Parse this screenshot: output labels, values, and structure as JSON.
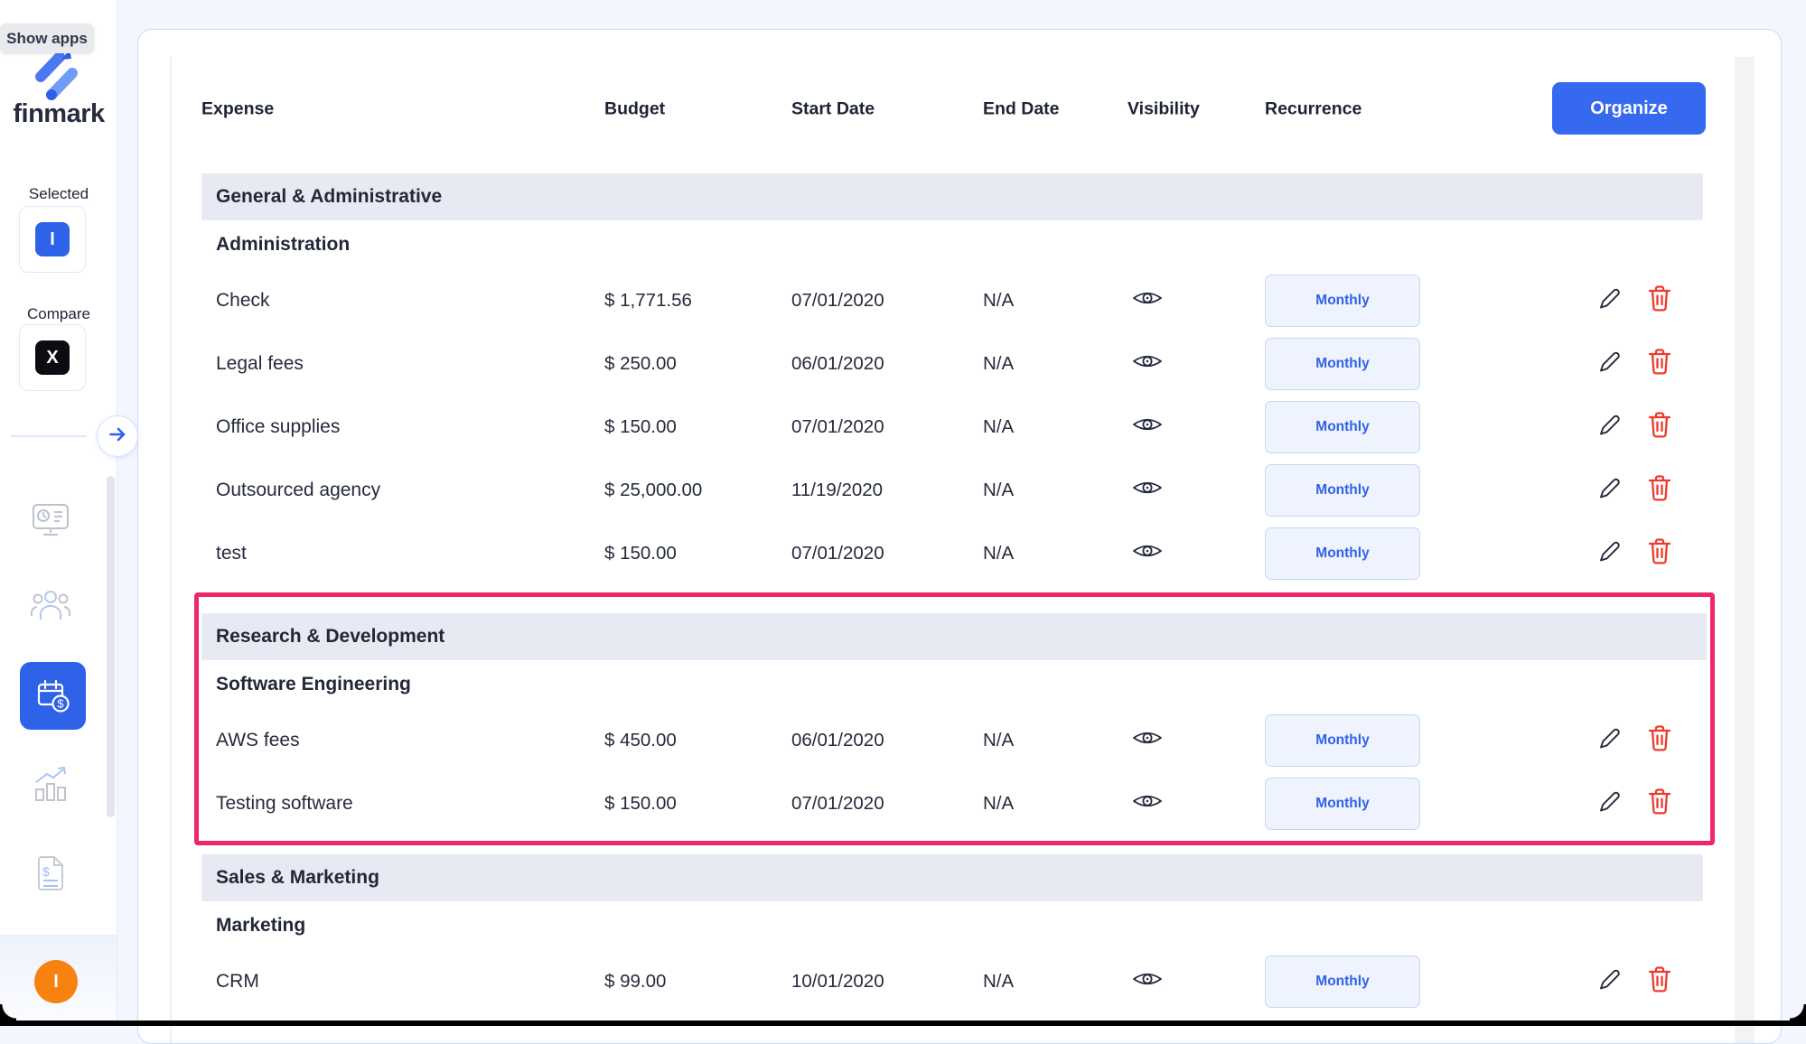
{
  "tooltip": "Show apps",
  "brand": "finmark",
  "sidebar": {
    "selected_label": "Selected",
    "selected_badge": "I",
    "compare_label": "Compare",
    "compare_badge": "X",
    "nav_icons": [
      "dashboard-monitor-icon",
      "team-people-icon",
      "expenses-calendar-dollar-icon",
      "charts-bar-trend-icon",
      "invoices-document-dollar-icon"
    ],
    "active_nav": "expenses-calendar-dollar-icon",
    "avatar_initial": "I"
  },
  "toolbar": {
    "organize_label": "Organize"
  },
  "table": {
    "columns": [
      "Expense",
      "Budget",
      "Start Date",
      "End Date",
      "Visibility",
      "Recurrence"
    ],
    "row_icons": [
      "eye-icon",
      "edit-pencil-icon",
      "delete-trash-icon"
    ],
    "sections": [
      {
        "name": "General & Administrative",
        "highlight": false,
        "subsections": [
          {
            "name": "Administration",
            "rows": [
              {
                "expense": "Check",
                "budget": "$ 1,771.56",
                "start": "07/01/2020",
                "end": "N/A",
                "recurrence": "Monthly"
              },
              {
                "expense": "Legal fees",
                "budget": "$ 250.00",
                "start": "06/01/2020",
                "end": "N/A",
                "recurrence": "Monthly"
              },
              {
                "expense": "Office supplies",
                "budget": "$ 150.00",
                "start": "07/01/2020",
                "end": "N/A",
                "recurrence": "Monthly"
              },
              {
                "expense": "Outsourced agency",
                "budget": "$ 25,000.00",
                "start": "11/19/2020",
                "end": "N/A",
                "recurrence": "Monthly"
              },
              {
                "expense": "test",
                "budget": "$ 150.00",
                "start": "07/01/2020",
                "end": "N/A",
                "recurrence": "Monthly"
              }
            ]
          }
        ]
      },
      {
        "name": "Research & Development",
        "highlight": true,
        "subsections": [
          {
            "name": "Software Engineering",
            "rows": [
              {
                "expense": "AWS fees",
                "budget": "$ 450.00",
                "start": "06/01/2020",
                "end": "N/A",
                "recurrence": "Monthly"
              },
              {
                "expense": "Testing software",
                "budget": "$ 150.00",
                "start": "07/01/2020",
                "end": "N/A",
                "recurrence": "Monthly"
              }
            ]
          }
        ]
      },
      {
        "name": "Sales & Marketing",
        "highlight": false,
        "subsections": [
          {
            "name": "Marketing",
            "rows": [
              {
                "expense": "CRM",
                "budget": "$ 99.00",
                "start": "10/01/2020",
                "end": "N/A",
                "recurrence": "Monthly"
              }
            ]
          }
        ]
      }
    ]
  },
  "colors": {
    "accent_blue": "#2e63e9",
    "organize_blue": "#3569ef",
    "highlight_pink": "#f0266b",
    "delete_red": "#ee3a2e",
    "band_gray": "#e7eaf3",
    "text_dark": "#232838",
    "avatar_orange": "#f8820f"
  }
}
